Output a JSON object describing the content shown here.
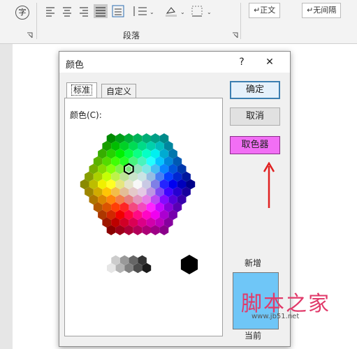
{
  "ribbon": {
    "group_label": "段落",
    "style_buttons": [
      "↵正文",
      "↵无间隔"
    ],
    "glyph": "字"
  },
  "dialog": {
    "title": "颜色",
    "help": "?",
    "close": "✕",
    "tabs": [
      {
        "label": "标准",
        "active": true
      },
      {
        "label": "自定义",
        "active": false
      }
    ],
    "colors_label": "颜色(C):",
    "ok_label": "确定",
    "cancel_label": "取消",
    "picker_label": "取色器",
    "new_label": "新增",
    "current_label": "当前",
    "new_color": "#6fc6f7",
    "picker_color": "#f26ef5",
    "arrow_color": "#e02020"
  },
  "watermark": {
    "text": "脚本之家",
    "url": "www.jb51.net"
  }
}
